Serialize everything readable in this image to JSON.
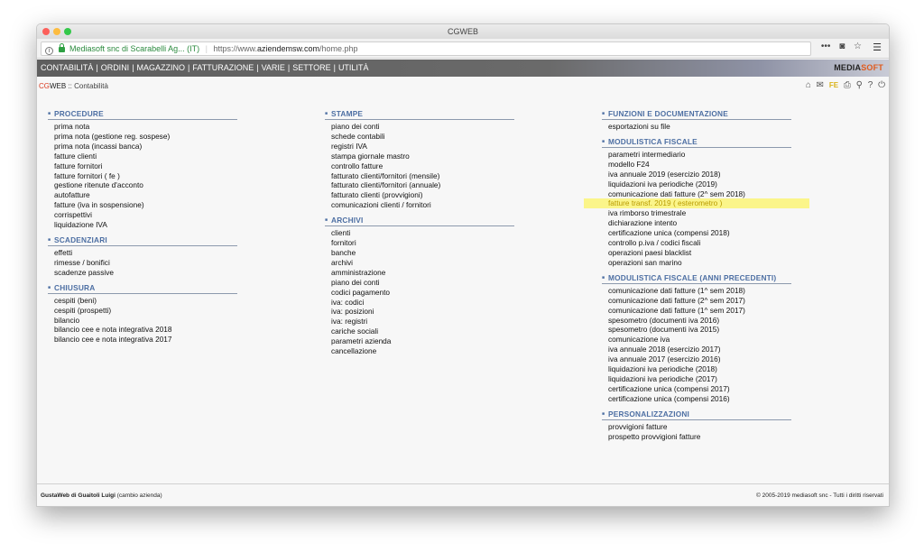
{
  "window": {
    "title": "CGWEB"
  },
  "browser": {
    "site_identity": "Mediasoft snc di Scarabelli Ag... (IT)",
    "url_prefix": "https://www.",
    "url_domain": "aziendemsw.com",
    "url_path": "/home.php"
  },
  "nav": {
    "items": [
      "CONTABILITÀ",
      "ORDINI",
      "MAGAZZINO",
      "FATTURAZIONE",
      "VARIE",
      "SETTORE",
      "UTILITÀ"
    ],
    "brand_a": "MEDIA",
    "brand_b": "SOFT"
  },
  "breadcrumb": {
    "cg": "CG",
    "web": "WEB",
    "sep": " :: ",
    "page": "Contabilità"
  },
  "toolbar": {
    "fe_label": "FE"
  },
  "columns": [
    {
      "sections": [
        {
          "title": "PROCEDURE",
          "items": [
            "prima nota",
            "prima nota (gestione reg. sospese)",
            "prima nota (incassi banca)",
            "fatture clienti",
            "fatture fornitori",
            "fatture fornitori ( fe )",
            "gestione ritenute d'acconto",
            "autofatture",
            "fatture (iva in sospensione)",
            "corrispettivi",
            "liquidazione IVA"
          ]
        },
        {
          "title": "SCADENZIARI",
          "items": [
            "effetti",
            "rimesse / bonifici",
            "scadenze passive"
          ]
        },
        {
          "title": "CHIUSURA",
          "items": [
            "cespiti (beni)",
            "cespiti (prospetti)",
            "bilancio",
            "bilancio cee e nota integrativa 2018",
            "bilancio cee e nota integrativa 2017"
          ]
        }
      ]
    },
    {
      "sections": [
        {
          "title": "STAMPE",
          "items": [
            "piano dei conti",
            "schede contabili",
            "registri IVA",
            "stampa giornale mastro",
            "controllo fatture",
            "fatturato clienti/fornitori (mensile)",
            "fatturato clienti/fornitori (annuale)",
            "fatturato clienti (provvigioni)",
            "comunicazioni clienti / fornitori"
          ]
        },
        {
          "title": "ARCHIVI",
          "items": [
            "clienti",
            "fornitori",
            "banche",
            "archivi",
            "amministrazione",
            "piano dei conti",
            "codici pagamento",
            "iva: codici",
            "iva: posizioni",
            "iva: registri",
            "cariche sociali",
            "parametri azienda",
            "cancellazione"
          ]
        }
      ]
    },
    {
      "sections": [
        {
          "title": "FUNZIONI E DOCUMENTAZIONE",
          "items": [
            "esportazioni su file"
          ]
        },
        {
          "title": "MODULISTICA FISCALE",
          "items": [
            "parametri intermediario",
            "modello F24",
            "iva annuale 2019 (esercizio 2018)",
            "liquidazioni iva periodiche (2019)",
            "comunicazione dati fatture (2^ sem 2018)",
            "fatture transf. 2019 ( esterometro )",
            "iva rimborso trimestrale",
            "dichiarazione intento",
            "certificazione unica (compensi 2018)",
            "controllo p.iva / codici fiscali",
            "operazioni paesi blacklist",
            "operazioni san marino"
          ]
        },
        {
          "title": "MODULISTICA FISCALE (ANNI PRECEDENTI)",
          "items": [
            "comunicazione dati fatture (1^ sem 2018)",
            "comunicazione dati fatture (2^ sem 2017)",
            "comunicazione dati fatture (1^ sem 2017)",
            "spesometro (documenti iva 2016)",
            "spesometro (documenti iva 2015)",
            "comunicazione iva",
            "iva annuale 2018 (esercizio 2017)",
            "iva annuale 2017 (esercizio 2016)",
            "liquidazioni iva periodiche (2018)",
            "liquidazioni iva periodiche (2017)",
            "certificazione unica (compensi 2017)",
            "certificazione unica (compensi 2016)"
          ]
        },
        {
          "title": "PERSONALIZZAZIONI",
          "items": [
            "provvigioni fatture",
            "prospetto provvigioni fatture"
          ]
        }
      ]
    }
  ],
  "footer": {
    "user": "GustaWeb di Guaitoli Luigi",
    "change": "(cambio azienda)",
    "copyright": "© 2005-2019 mediasoft snc - Tutti i diritti riservati"
  }
}
